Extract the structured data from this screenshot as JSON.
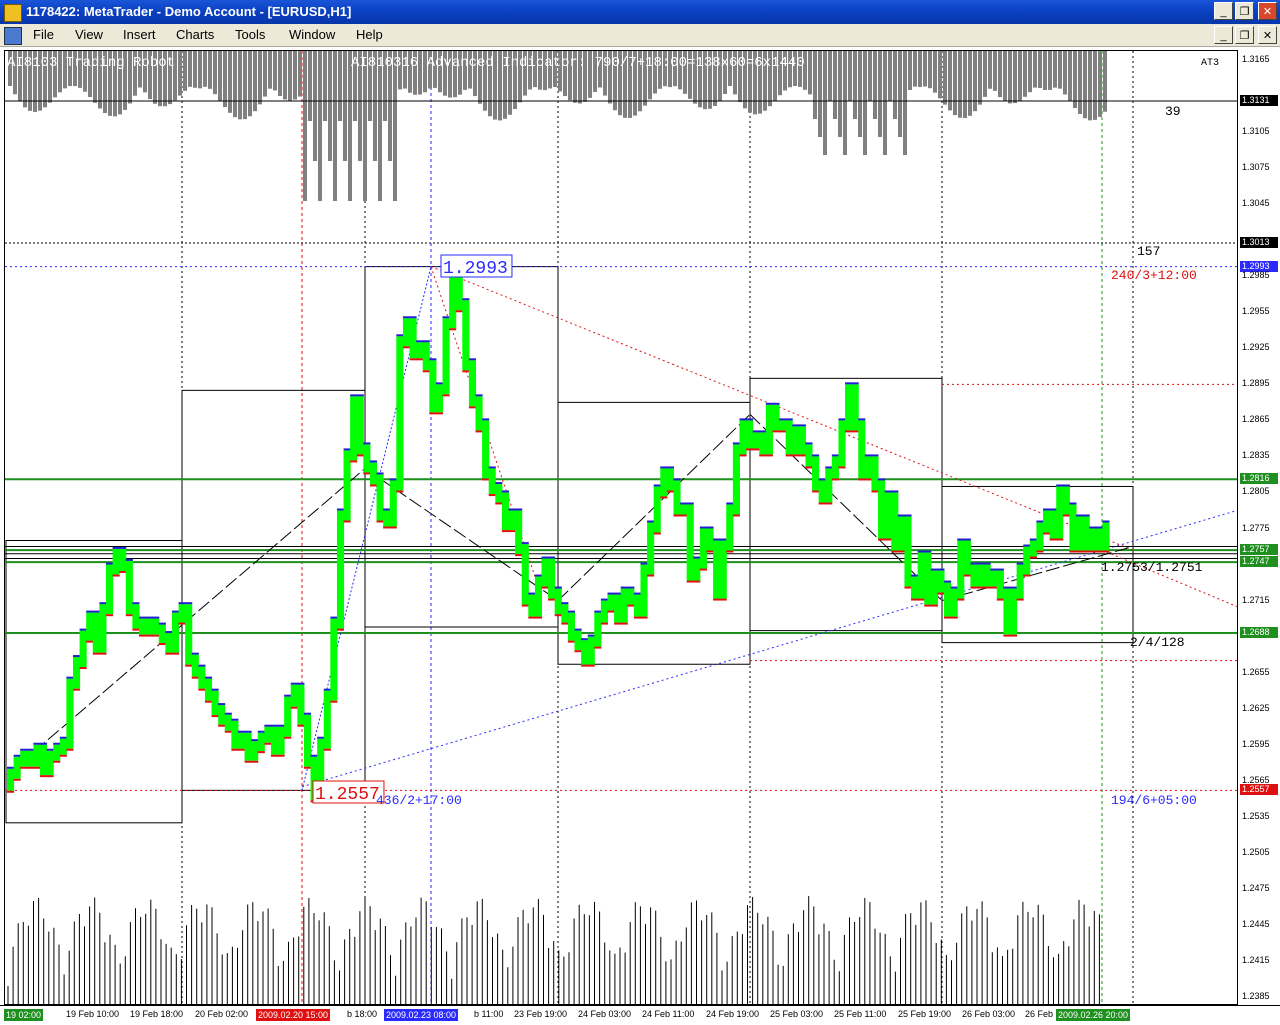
{
  "window": {
    "title": "1178422: MetaTrader - Demo Account - [EURUSD,H1]"
  },
  "menu": [
    "File",
    "View",
    "Insert",
    "Charts",
    "Tools",
    "Window",
    "Help"
  ],
  "chart": {
    "robot_label": "AI8103 Trading Robot",
    "indicator_label": "AI810316 Advanced Indicator: 790/7+18:00=138x60=6x1440",
    "corner_label": "AT3",
    "smile": "☺",
    "annotations": {
      "count_39": "39",
      "count_157": "157",
      "time_red": "240/3+12:00",
      "high_box": "1.2993",
      "low_box": "1.2557",
      "time_blue_left": "436/2+17:00",
      "time_blue_right": "194/6+05:00",
      "ratio": "1.2753/1.2751",
      "count_right": "2/4/128"
    }
  },
  "price_axis": {
    "ticks": [
      "1.3165",
      "1.3131",
      "1.3105",
      "1.3075",
      "1.3045",
      "1.3013",
      "1.2993",
      "1.2985",
      "1.2955",
      "1.2925",
      "1.2895",
      "1.2865",
      "1.2835",
      "1.2816",
      "1.2805",
      "1.2775",
      "1.2757",
      "1.2747",
      "1.2715",
      "1.2688",
      "1.2655",
      "1.2625",
      "1.2595",
      "1.2565",
      "1.2557",
      "1.2535",
      "1.2505",
      "1.2475",
      "1.2445",
      "1.2415",
      "1.2385"
    ],
    "highlights": [
      {
        "label": "1.3131",
        "color": "#000000"
      },
      {
        "label": "1.3013",
        "color": "#000000"
      },
      {
        "label": "1.2993",
        "color": "#2a2aff"
      },
      {
        "label": "1.2816",
        "color": "#1f8f1f"
      },
      {
        "label": "1.2757",
        "color": "#1f8f1f"
      },
      {
        "label": "1.2747",
        "color": "#1f8f1f"
      },
      {
        "label": "1.2688",
        "color": "#1f8f1f"
      },
      {
        "label": "1.2557",
        "color": "#e01010"
      }
    ]
  },
  "time_axis": {
    "labels": [
      "19 02:00",
      "19 Feb 10:00",
      "19 Feb 18:00",
      "20 Feb 02:00",
      "2009.02.20 15:00",
      "b 18:00",
      "2009.02.23 08:00",
      "b 11:00",
      "23 Feb 19:00",
      "24 Feb 03:00",
      "24 Feb 11:00",
      "24 Feb 19:00",
      "25 Feb 03:00",
      "25 Feb 11:00",
      "25 Feb 19:00",
      "26 Feb 03:00",
      "26 Feb",
      "2009.02.26 20:00"
    ],
    "boxes": [
      {
        "label": "19 02:00",
        "color": "#1f8f1f"
      },
      {
        "label": "2009.02.20 15:00",
        "color": "#e01010"
      },
      {
        "label": "2009.02.23 08:00",
        "color": "#2a2aff"
      },
      {
        "label": "2009.02.26 20:00",
        "color": "#1f8f1f"
      }
    ]
  },
  "chart_data": {
    "type": "line",
    "symbol": "EURUSD,H1",
    "ylim": [
      1.2385,
      1.3165
    ],
    "high": 1.2993,
    "low": 1.2557,
    "levels": [
      1.2816,
      1.2757,
      1.2747,
      1.2688
    ],
    "series": [
      {
        "values": [
          1.2565,
          1.2575,
          1.2585,
          1.259,
          1.2585,
          1.2595,
          1.2578,
          1.259,
          1.2595,
          1.26,
          1.265,
          1.2668,
          1.269,
          1.2705,
          1.268,
          1.2712,
          1.2745,
          1.2758,
          1.2748,
          1.2712,
          1.27,
          1.2695,
          1.27,
          1.2695,
          1.2688,
          1.268,
          1.2705,
          1.2712,
          1.267,
          1.266,
          1.265,
          1.264,
          1.2628,
          1.262,
          1.2615,
          1.26,
          1.2605,
          1.259,
          1.2598,
          1.2605,
          1.261,
          1.2595,
          1.261,
          1.2635,
          1.2645,
          1.262,
          1.2585,
          1.2557,
          1.26,
          1.264,
          1.27,
          1.279,
          1.284,
          1.2885,
          1.2845,
          1.283,
          1.282,
          1.279,
          1.2785,
          1.2815,
          1.2935,
          1.295,
          1.2925,
          1.293,
          1.2915,
          1.288,
          1.2895,
          1.295,
          1.2993,
          1.2965,
          1.2915,
          1.2885,
          1.2865,
          1.2825,
          1.2812,
          1.2805,
          1.2782,
          1.279,
          1.2762,
          1.272,
          1.271,
          1.2735,
          1.275,
          1.2725,
          1.2712,
          1.2705,
          1.269,
          1.2682,
          1.267,
          1.2685,
          1.2705,
          1.2715,
          1.272,
          1.2705,
          1.2725,
          1.272,
          1.271,
          1.2745,
          1.278,
          1.281,
          1.2825,
          1.2815,
          1.2795,
          1.2795,
          1.274,
          1.275,
          1.2775,
          1.2765,
          1.2725,
          1.2765,
          1.2795,
          1.2845,
          1.2865,
          1.285,
          1.2855,
          1.2845,
          1.2878,
          1.2865,
          1.2865,
          1.2845,
          1.286,
          1.2845,
          1.2835,
          1.2815,
          1.2805,
          1.2825,
          1.2835,
          1.2865,
          1.2895,
          1.2865,
          1.2825,
          1.2835,
          1.2815,
          1.2775,
          1.2805,
          1.2765,
          1.2785,
          1.2735,
          1.2725,
          1.2755,
          1.272,
          1.274,
          1.273,
          1.271,
          1.2725,
          1.2765,
          1.2745,
          1.2735,
          1.2745,
          1.2735,
          1.274,
          1.2725,
          1.2695,
          1.2725,
          1.2745,
          1.276,
          1.2765,
          1.278,
          1.279,
          1.2775,
          1.281,
          1.2795,
          1.2765,
          1.2785,
          1.2765,
          1.2775,
          1.2765,
          1.278
        ]
      }
    ]
  }
}
